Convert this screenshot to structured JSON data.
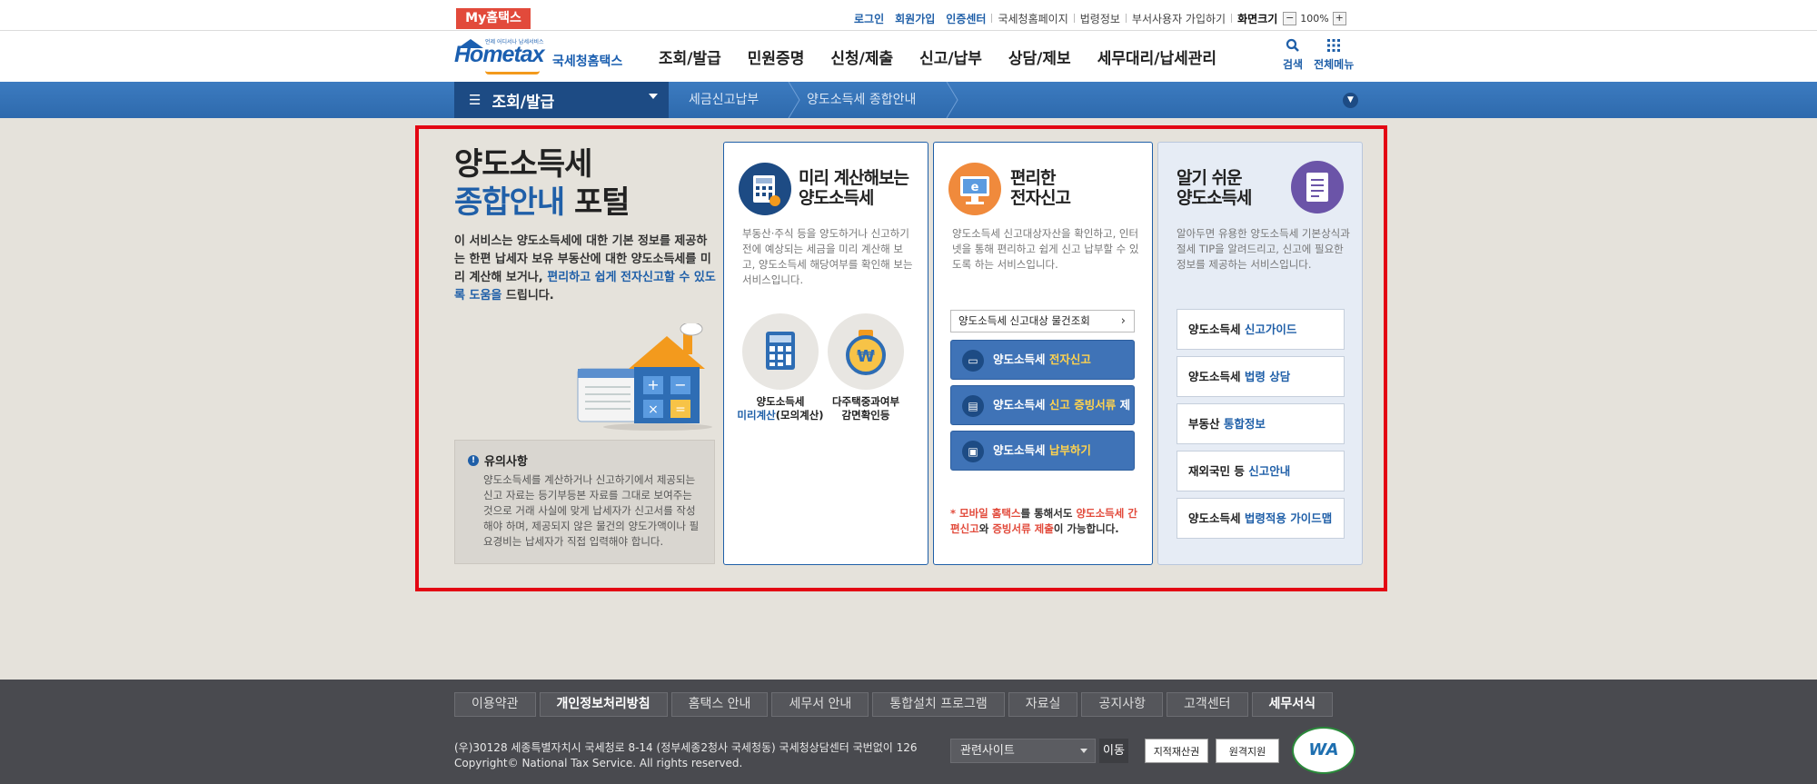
{
  "topbar": {
    "my_hometax": "My홈택스",
    "links": [
      {
        "label": "로그인",
        "style": "blue"
      },
      {
        "label": "회원가입",
        "style": "blue"
      },
      {
        "label": "인증센터",
        "style": "blue"
      },
      {
        "label": "국세청홈페이지",
        "style": "plain"
      },
      {
        "label": "법령정보",
        "style": "plain"
      },
      {
        "label": "부서사용자 가입하기",
        "style": "plain"
      }
    ],
    "zoom_label": "화면크기",
    "zoom_value": "100%",
    "zoom_out": "−",
    "zoom_in": "+"
  },
  "header": {
    "logo_en": "Hometax",
    "logo_ko": "국세청홈택스",
    "logo_sub": "언제 어디서나 납세서비스",
    "menu": [
      "조회/발급",
      "민원증명",
      "신청/제출",
      "신고/납부",
      "상담/제보",
      "세무대리/납세관리"
    ],
    "search_label": "검색",
    "allmenu_label": "전체메뉴"
  },
  "breadcrumb": {
    "current_section": "조회/발급",
    "items": [
      "세금신고납부",
      "양도소득세 종합안내"
    ]
  },
  "intro": {
    "title_line1": "양도소득세",
    "title_line2_hl": "종합안내",
    "title_line2_rest": " 포털",
    "desc_plain": "이 서비스는 양도소득세에 대한 기본 정보를 제공하는 한편 납세자 보유 부동산에 대한 양도소득세를 미리 계산해 보거나, ",
    "desc_hl": "편리하고 쉽게 전자신고할 수 있도록 도움을",
    "desc_tail": " 드립니다."
  },
  "notice": {
    "title": "유의사항",
    "body": "양도소득세를 계산하거나 신고하기에서 제공되는 신고 자료는 등기부등본 자료를 그대로 보여주는 것으로 거래 사실에 맞게 납세자가 신고서를 작성해야 하며, 제공되지 않은 물건의 양도가액이나 필요경비는 납세자가 직접 입력해야 합니다."
  },
  "card_calc": {
    "title_line1": "미리 계산해보는",
    "title_line2": "양도소득세",
    "desc": "부동산·주식 등을 양도하거나 신고하기 전에 예상되는 세금을 미리 계산해 보고, 양도소득세 해당여부를 확인해 보는 서비스입니다.",
    "btn1_line1": "양도소득세",
    "btn1_line2_hl": "미리계산",
    "btn1_line2_rest": "(모의계산)",
    "btn2_line1": "다주택중과여부",
    "btn2_line2": "감면확인등"
  },
  "card_efile": {
    "title_line1": "편리한",
    "title_line2": "전자신고",
    "desc": "양도소득세 신고대상자산을 확인하고, 인터넷을 통해 편리하고 쉽게 신고 납부할 수 있도록 하는 서비스입니다.",
    "lookup": "양도소득세 신고대상 물건조회",
    "buttons": [
      {
        "prefix": "양도소득세 ",
        "hl": "전자신고",
        "suffix": ""
      },
      {
        "prefix": "양도소득세 ",
        "hl": "신고 증빙서류",
        "suffix": " 제출"
      },
      {
        "prefix": "양도소득세 ",
        "hl": "납부하기",
        "suffix": ""
      }
    ],
    "note_a": "* 모바일 홈택스",
    "note_b": "를 통해서도 ",
    "note_c": "양도소득세 간편신고",
    "note_d": "와 ",
    "note_e": "증빙서류 제출",
    "note_f": "이 가능합니다."
  },
  "card_guide": {
    "title_line1": "알기 쉬운",
    "title_line2": "양도소득세",
    "desc": "알아두면 유용한 양도소득세 기본상식과 절세 TIP을 알려드리고, 신고에 필요한 정보를 제공하는 서비스입니다.",
    "buttons": [
      {
        "prefix": "양도소득세 ",
        "hl": "신고가이드"
      },
      {
        "prefix": "양도소득세 ",
        "hl": "법령 상담"
      },
      {
        "prefix": "부동산 ",
        "hl": "통합정보"
      },
      {
        "prefix": "재외국민 등 ",
        "hl": "신고안내"
      },
      {
        "prefix": "양도소득세 ",
        "hl": "법령적용 가이드맵"
      }
    ]
  },
  "footer": {
    "links": [
      {
        "label": "이용약관",
        "bold": false
      },
      {
        "label": "개인정보처리방침",
        "bold": true
      },
      {
        "label": "홈택스 안내",
        "bold": false
      },
      {
        "label": "세무서 안내",
        "bold": false
      },
      {
        "label": "통합설치 프로그램",
        "bold": false
      },
      {
        "label": "자료실",
        "bold": false
      },
      {
        "label": "공지사항",
        "bold": false
      },
      {
        "label": "고객센터",
        "bold": false
      },
      {
        "label": "세무서식",
        "bold": true
      }
    ],
    "address": "(우)30128 세종특별자치시 국세청로 8-14 (정부세종2청사 국세청동) 국세청상담센터 국번없이 126",
    "copyright": "Copyright© National Tax Service. All rights reserved.",
    "related_sites": "관련사이트",
    "go": "이동",
    "badge1": "지적재산권",
    "badge2": "원격지원",
    "wa": "WA"
  }
}
